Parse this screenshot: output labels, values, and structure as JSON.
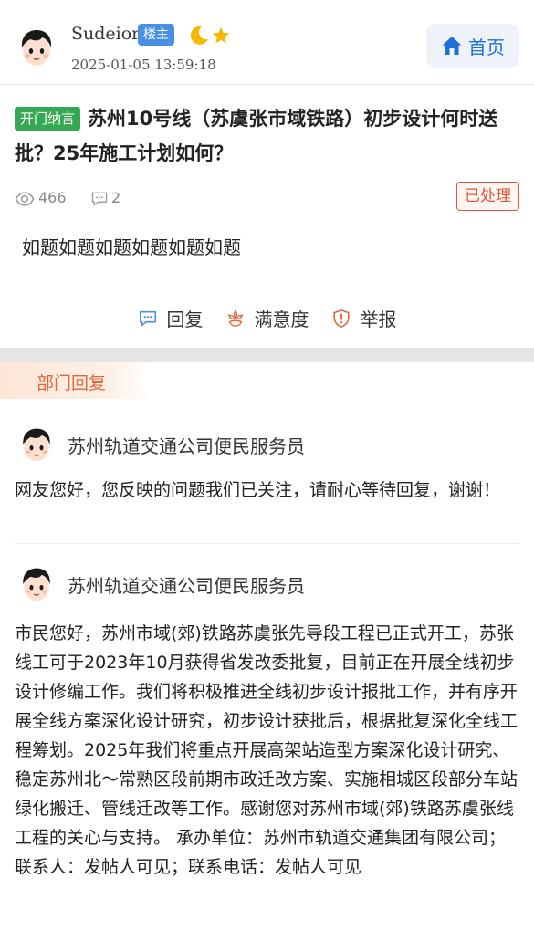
{
  "post": {
    "author": "Sudeior",
    "owner_badge": "楼主",
    "time": "2025-01-05 13:59:18",
    "tag": "开门纳言",
    "title": "苏州10号线（苏虞张市域铁路）初步设计何时送批？25年施工计划如何？",
    "views": "466",
    "comments": "2",
    "status": "已处理",
    "body": "如题如题如题如题如题如题",
    "icons": [
      "moon-icon",
      "star-icon",
      "eye-icon",
      "comment-icon"
    ]
  },
  "nav": {
    "home_label": "首页",
    "home_icon": "house-icon"
  },
  "actions": [
    {
      "label": "回复",
      "icon": "reply-icon"
    },
    {
      "label": "满意度",
      "icon": "flower-icon"
    },
    {
      "label": "举报",
      "icon": "report-icon"
    }
  ],
  "section": {
    "dept_label": "部门回复"
  },
  "replies": [
    {
      "name": "苏州轨道交通公司便民服务员",
      "text": "网友您好，您反映的问题我们已关注，请耐心等待回复，谢谢！"
    },
    {
      "name": "苏州轨道交通公司便民服务员",
      "text": "市民您好，苏州市域(郊)铁路苏虞张先导段工程已正式开工，苏张线工可于2023年10月获得省发改委批复，目前正在开展全线初步设计修编工作。我们将积极推进全线初步设计报批工作，并有序开展全线方案深化设计研究，初步设计获批后，根据批复深化全线工程筹划。2025年我们将重点开展高架站造型方案深化设计研究、稳定苏州北～常熟区段前期市政迁改方案、实施相城区段部分车站绿化搬迁、管线迁改等工作。感谢您对苏州市域(郊)铁路苏虞张线工程的关心与支持。 承办单位：苏州市轨道交通集团有限公司；联系人：发帖人可见；联系电话：发帖人可见"
    }
  ],
  "colors": {
    "accent_blue": "#1f6fd6",
    "tag_green": "#35a853",
    "status_red": "#e0563e",
    "dept_orange": "#e0663e"
  }
}
